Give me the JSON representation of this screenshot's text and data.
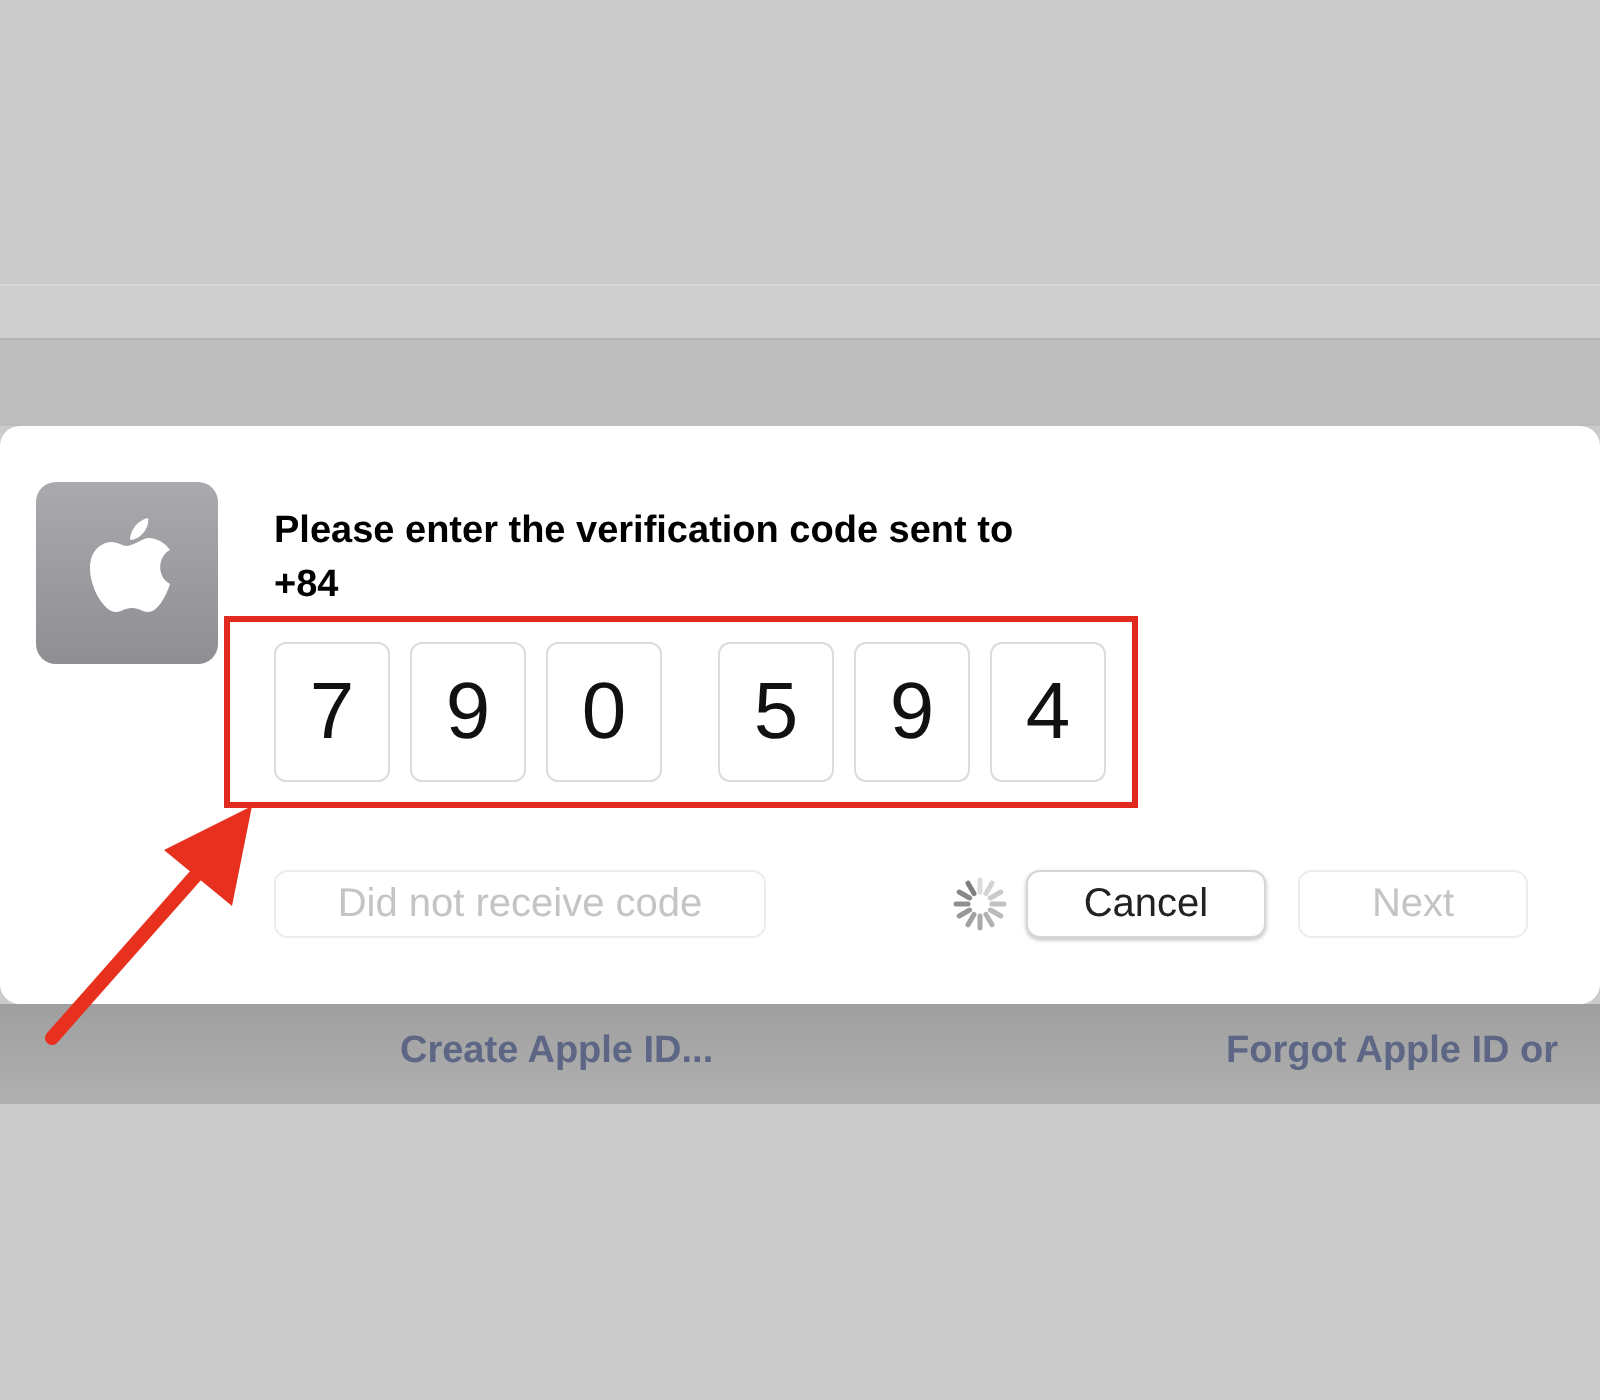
{
  "dialog": {
    "title": "Please enter the verification code sent to",
    "phone": "+84",
    "code_digits": [
      "7",
      "9",
      "0",
      "5",
      "9",
      "4"
    ],
    "buttons": [
      {
        "label": "Did not receive code",
        "disabled": true
      },
      {
        "label": "Cancel",
        "disabled": false
      },
      {
        "label": "Next",
        "disabled": true
      }
    ],
    "loading": true
  },
  "background_links": [
    "Create Apple ID...",
    "Forgot Apple ID or"
  ]
}
